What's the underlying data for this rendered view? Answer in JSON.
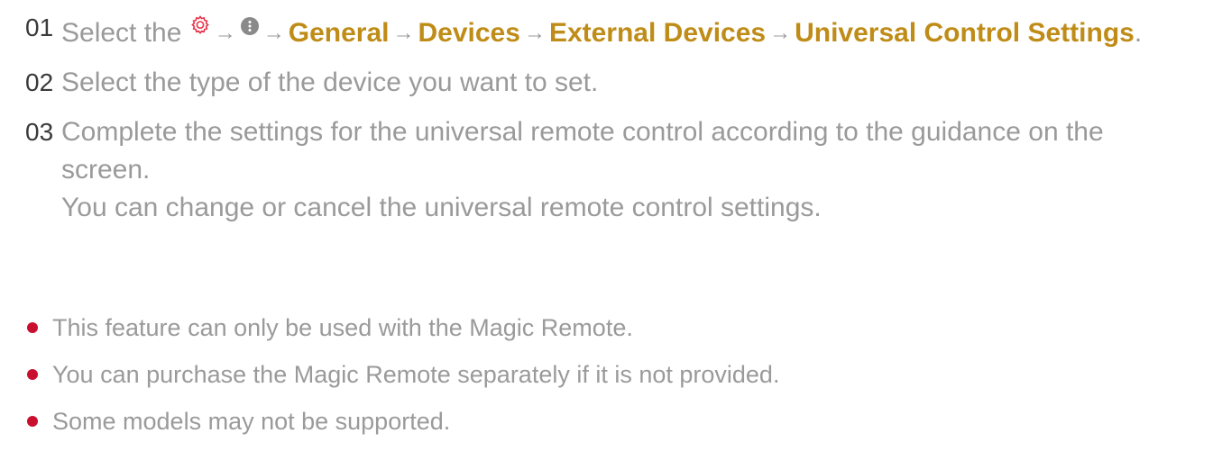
{
  "steps": [
    {
      "number": "01",
      "prefix": "Select the",
      "path": [
        "General",
        "Devices",
        "External Devices",
        "Universal Control Settings"
      ],
      "suffix": "."
    },
    {
      "number": "02",
      "text": "Select the type of the device you want to set."
    },
    {
      "number": "03",
      "text": "Complete the settings for the universal remote control according to the guidance on the screen.",
      "note": "You can change or cancel the universal remote control settings."
    }
  ],
  "bullets": [
    "This feature can only be used with the Magic Remote.",
    "You can purchase the Magic Remote separately if it is not provided.",
    "Some models may not be supported."
  ],
  "icons": {
    "settings": "gear-icon",
    "more": "more-options-icon",
    "arrow": "→"
  },
  "colors": {
    "highlight": "#bf8c17",
    "bullet": "#c8102e",
    "text": "#9a9a9a",
    "step_number": "#3a3a3a",
    "gear": "#e8334a",
    "more": "#8a8a8a"
  }
}
